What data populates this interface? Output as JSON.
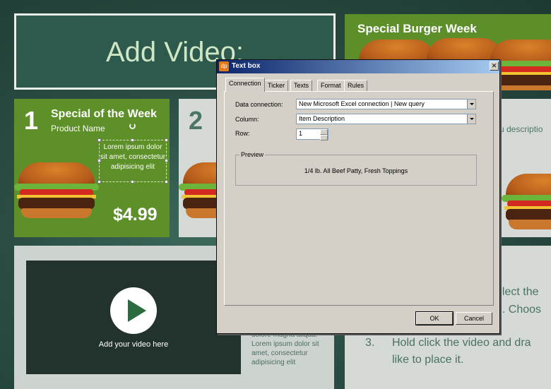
{
  "slide": {
    "title": "Add Video:",
    "header_title": "Special Burger Week",
    "card1": {
      "number": "1",
      "title": "Special of the Week",
      "subtitle": "Product Name",
      "description": "Lorem ipsum dolor sit amet, consectetur adipisicing elit",
      "price": "$4.99"
    },
    "card2": {
      "number": "2"
    },
    "right_card": {
      "description_fragment": "u descriptio"
    },
    "video": {
      "label": "Add your video here"
    },
    "lorem_fragment": "dolore magna aliqua. Lorem ipsum dolor sit amet, consectetur adipisicing elit",
    "steps": {
      "line1": "elect the",
      "line2": "n.  Choos",
      "step3_number": "3.",
      "step3_line1": "Hold click the video and dra",
      "step3_line2": "like to place it."
    }
  },
  "dialog": {
    "title": "Text box",
    "icon": "app-icon",
    "icon_text": "dp",
    "close_label": "✕",
    "tabs": [
      "Connection",
      "Ticker",
      "Texts",
      "Format",
      "Rules"
    ],
    "active_tab": "Connection",
    "fields": {
      "data_connection_label": "Data connection:",
      "data_connection_value": "New Microsoft Excel connection | New query",
      "column_label": "Column:",
      "column_value": "Item Description",
      "row_label": "Row:",
      "row_value": "1"
    },
    "preview": {
      "label": "Preview",
      "text": "1/4 lb. All Beef Patty, Fresh Toppings"
    },
    "buttons": {
      "ok": "OK",
      "cancel": "Cancel"
    }
  },
  "colors": {
    "green_card": "#5d9028",
    "dialog_face": "#d4d0c8",
    "titlebar_start": "#0a246a"
  }
}
